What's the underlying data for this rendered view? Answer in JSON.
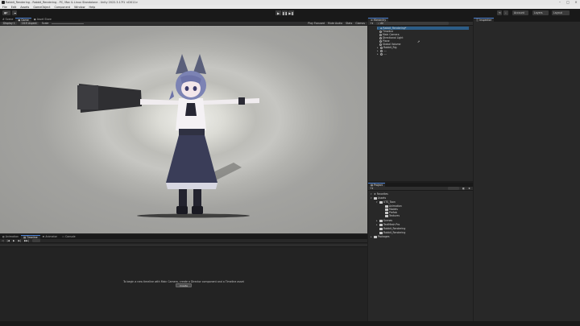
{
  "window": {
    "title": "Rabbit_Rendering - Rabbit_Rendering - PC, Mac & Linux Standalone - Unity 2022.3.17f1 <DX11>"
  },
  "menu": [
    "File",
    "Edit",
    "Assets",
    "GameObject",
    "Component",
    "Window",
    "Help"
  ],
  "toolbar": {
    "account_label": "Account",
    "layers_label": "Layers",
    "layout_label": "Layout"
  },
  "scene": {
    "tabs": [
      "Scene",
      "Game",
      "Asset Store"
    ],
    "subbar": {
      "display": "Display 1",
      "aspect": "16:9 Aspect",
      "scale": "Scale",
      "play_focused": "Play Focused",
      "mute": "Mute Audio",
      "stats": "Stats",
      "gizmos": "Gizmos"
    }
  },
  "hierarchy": {
    "tab_label": "Hierarchy",
    "search_placeholder": "All",
    "scene_name": "Rabbit_Rendering*",
    "items": [
      {
        "label": "Timeline"
      },
      {
        "label": "Main Camera"
      },
      {
        "label": "Directional Light"
      },
      {
        "label": "Plane"
      },
      {
        "label": "Global Volume"
      },
      {
        "label": "Rabbit_Rig"
      },
      {
        "label": "...."
      },
      {
        "label": "...."
      }
    ]
  },
  "inspector": {
    "tab_label": "Inspector"
  },
  "project": {
    "tab_label": "Project",
    "assets_label": "Assets",
    "tree": [
      {
        "label": "Favorites"
      },
      {
        "label": "Assets"
      },
      {
        "label": "UTS_Toon"
      },
      {
        "label": "Animation"
      },
      {
        "label": "Models"
      },
      {
        "label": "Prefab"
      },
      {
        "label": "Textures"
      },
      {
        "label": "Scenes"
      },
      {
        "label": "TextMesh Pro"
      },
      {
        "label": "Rabbit_Rendering"
      },
      {
        "label": "Rabbit_Rendering"
      },
      {
        "label": "Packages"
      }
    ]
  },
  "bottom": {
    "tabs": [
      "Animation",
      "Timeline",
      "Animator",
      "Console"
    ],
    "timeline_message": "To begin a new timeline with Main Camera, create a Director component and a Timeline asset",
    "create_button": "Create"
  },
  "colors": {
    "accent": "#4a7fd0",
    "panel": "#282828",
    "dark": "#191919"
  }
}
